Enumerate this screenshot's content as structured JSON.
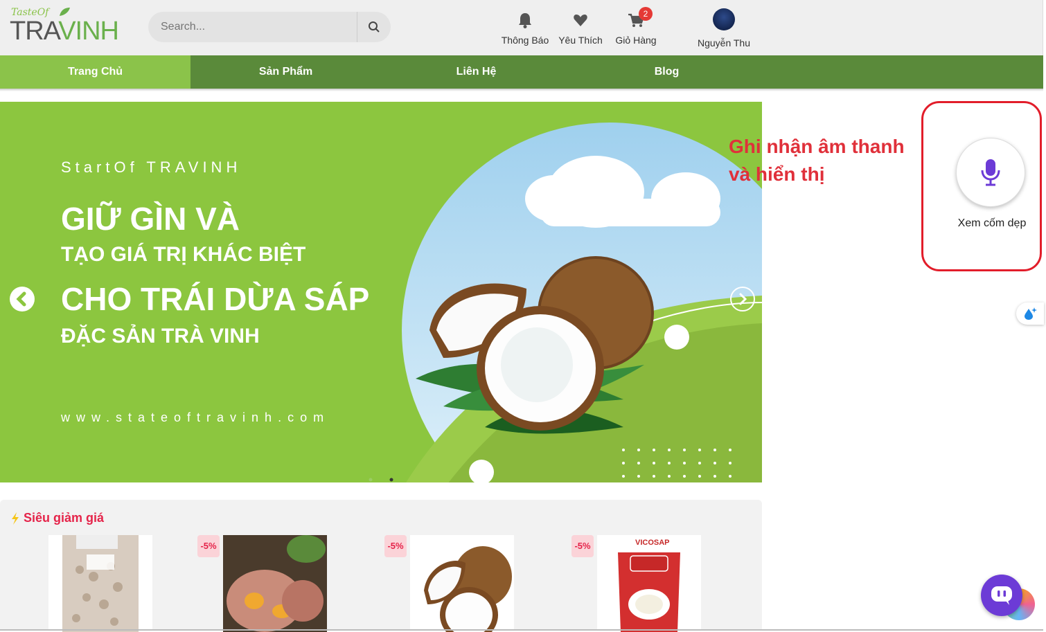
{
  "logo": {
    "small": "TasteOf",
    "main_left": "TRA",
    "main_right": "VINH"
  },
  "search": {
    "placeholder": "Search..."
  },
  "header": {
    "notifications_label": "Thông Báo",
    "favorites_label": "Yêu Thích",
    "cart_label": "Giỏ Hàng",
    "cart_count": "2",
    "user_name": "Nguyễn Thu"
  },
  "nav": [
    {
      "label": "Trang Chủ",
      "active": true
    },
    {
      "label": "Sản Phẩm",
      "active": false
    },
    {
      "label": "Liên Hệ",
      "active": false
    },
    {
      "label": "Blog",
      "active": false
    }
  ],
  "banner": {
    "brand": "StartOf TRAVINH",
    "line1": "GIỮ GÌN VÀ",
    "line2": "TẠO GIÁ TRỊ KHÁC BIỆT",
    "line3": "CHO TRÁI DỪA SÁP",
    "line4": "ĐẶC SẢN TRÀ VINH",
    "url": "www.stateoftravinh.com"
  },
  "annotation": {
    "line1": "Ghi nhận âm thanh",
    "line2": "và hiển thị"
  },
  "voice": {
    "transcript": "Xem cốm dẹp"
  },
  "sale": {
    "title": "Siêu giảm giá",
    "products": [
      {
        "discount": ""
      },
      {
        "discount": "-5%"
      },
      {
        "discount": "-5%"
      },
      {
        "discount": "-5%"
      }
    ],
    "package_text": "VICOSAP"
  },
  "colors": {
    "nav": "#5a8a3a",
    "nav_active": "#8bc34a",
    "banner": "#8cc63f",
    "accent_red": "#e0303a",
    "mic": "#6c3bd6"
  }
}
